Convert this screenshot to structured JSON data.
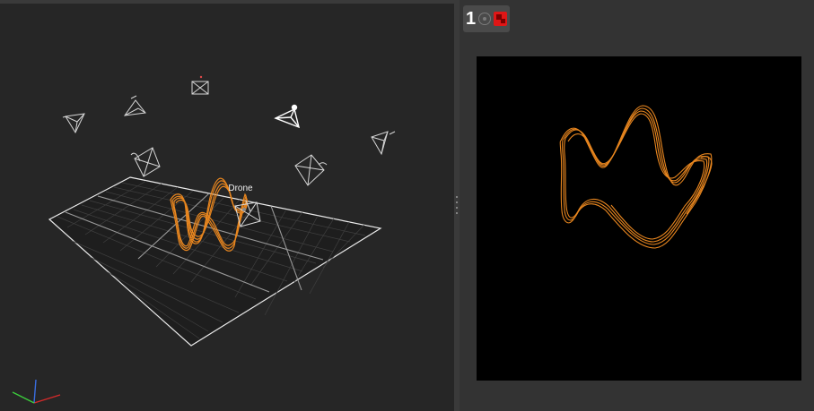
{
  "viewport3d": {
    "object_label": "Drone",
    "background": "#262626",
    "grid_line_color": "#e6e6e6",
    "path_color": "#e8861f",
    "camera_color": "#d9d9d9",
    "axis_colors": {
      "x": "#d42a2a",
      "y": "#3a6ee0",
      "z": "#3ccc3c"
    }
  },
  "camera_view": {
    "camera_number": "1",
    "background": "#000000",
    "path_color": "#e8861f",
    "record_color": "#e01616"
  },
  "icons": {
    "target": "target-icon",
    "record": "record-icon",
    "axis": "axis-gizmo-icon",
    "camera": "camera-frustum-icon"
  }
}
